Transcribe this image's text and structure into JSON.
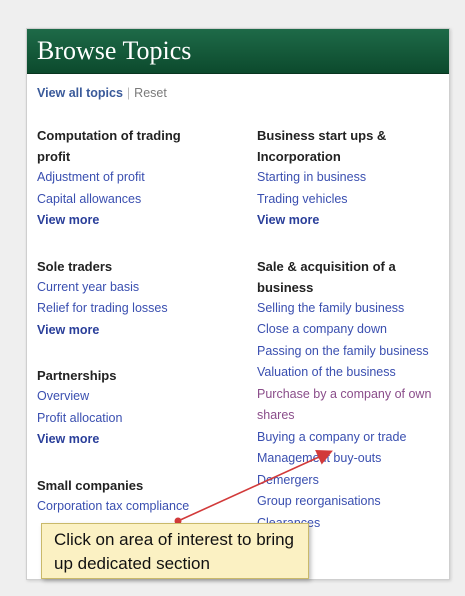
{
  "header": {
    "title": "Browse Topics"
  },
  "subnav": {
    "view_all": "View all topics",
    "separator": "|",
    "reset": "Reset"
  },
  "left_groups": [
    {
      "heading": "Computation of trading profit",
      "links": [
        "Adjustment of profit",
        "Capital allowances"
      ],
      "more": "View more"
    },
    {
      "heading": "Sole traders",
      "links": [
        "Current year basis",
        "Relief for trading losses"
      ],
      "more": "View more"
    },
    {
      "heading": "Partnerships",
      "links": [
        "Overview",
        "Profit allocation"
      ],
      "more": "View more"
    },
    {
      "heading": "Small companies",
      "links": [
        "Corporation tax compliance"
      ]
    }
  ],
  "right_groups": [
    {
      "heading": "Business start ups & Incorporation",
      "links": [
        "Starting in business",
        "Trading vehicles"
      ],
      "more": "View more"
    },
    {
      "heading": "Sale & acquisition of a business",
      "links": [
        "Selling the family business",
        "Close a company down",
        "Passing on the family business",
        "Valuation of the business",
        "Purchase by a company of own shares",
        "Buying a company or trade",
        "Management buy-outs",
        "Demergers",
        "Group reorganisations",
        "Clearances"
      ]
    }
  ],
  "callout": {
    "text": "Click on area of interest to bring up dedicated section"
  },
  "colors": {
    "header_bg": "#0f5336",
    "link": "#3a4fb0",
    "visited_link": "#8a4d8a",
    "callout_bg": "#fbf1c3",
    "arrow": "#d23a3a"
  }
}
